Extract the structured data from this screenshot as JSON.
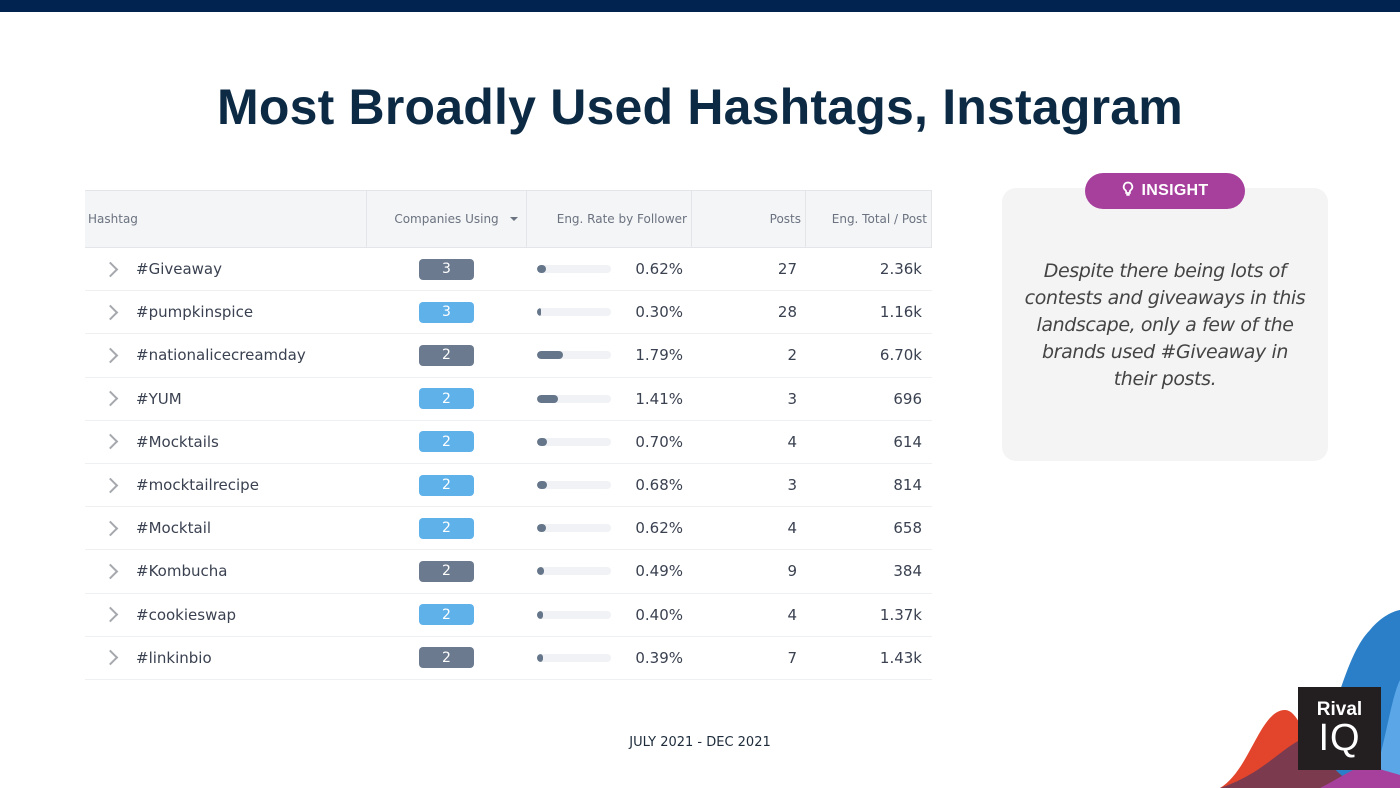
{
  "title": "Most Broadly Used Hashtags, Instagram",
  "table": {
    "headers": {
      "hashtag": "Hashtag",
      "companies_using": "Companies Using",
      "eng_rate": "Eng. Rate by Follower",
      "posts": "Posts",
      "eng_total": "Eng. Total / Post"
    },
    "eng_rate_scale_max_percent": 5,
    "rows": [
      {
        "hashtag": "#Giveaway",
        "companies": "3",
        "badge": "dark",
        "rate": "0.62%",
        "rate_value": 0.62,
        "posts": "27",
        "eng_total": "2.36k"
      },
      {
        "hashtag": "#pumpkinspice",
        "companies": "3",
        "badge": "light",
        "rate": "0.30%",
        "rate_value": 0.3,
        "posts": "28",
        "eng_total": "1.16k"
      },
      {
        "hashtag": "#nationalicecreamday",
        "companies": "2",
        "badge": "dark",
        "rate": "1.79%",
        "rate_value": 1.79,
        "posts": "2",
        "eng_total": "6.70k"
      },
      {
        "hashtag": "#YUM",
        "companies": "2",
        "badge": "light",
        "rate": "1.41%",
        "rate_value": 1.41,
        "posts": "3",
        "eng_total": "696"
      },
      {
        "hashtag": "#Mocktails",
        "companies": "2",
        "badge": "light",
        "rate": "0.70%",
        "rate_value": 0.7,
        "posts": "4",
        "eng_total": "614"
      },
      {
        "hashtag": "#mocktailrecipe",
        "companies": "2",
        "badge": "light",
        "rate": "0.68%",
        "rate_value": 0.68,
        "posts": "3",
        "eng_total": "814"
      },
      {
        "hashtag": "#Mocktail",
        "companies": "2",
        "badge": "light",
        "rate": "0.62%",
        "rate_value": 0.62,
        "posts": "4",
        "eng_total": "658"
      },
      {
        "hashtag": "#Kombucha",
        "companies": "2",
        "badge": "dark",
        "rate": "0.49%",
        "rate_value": 0.49,
        "posts": "9",
        "eng_total": "384"
      },
      {
        "hashtag": "#cookieswap",
        "companies": "2",
        "badge": "light",
        "rate": "0.40%",
        "rate_value": 0.4,
        "posts": "4",
        "eng_total": "1.37k"
      },
      {
        "hashtag": "#linkinbio",
        "companies": "2",
        "badge": "dark",
        "rate": "0.39%",
        "rate_value": 0.39,
        "posts": "7",
        "eng_total": "1.43k"
      }
    ]
  },
  "insight": {
    "label": "INSIGHT",
    "icon": "lightbulb-icon",
    "text": "Despite there being lots of contests and giveaways in this landscape, only a few of the brands used #Giveaway in their posts."
  },
  "footer": {
    "date_range": "JULY 2021 - DEC 2021"
  },
  "logo": {
    "line1": "Rival",
    "line2": "IQ"
  },
  "colors": {
    "topbar": "#00234f",
    "title": "#0c2a44",
    "badge_dark": "#6b7a8e",
    "badge_light": "#5fb1ea",
    "insight_pill": "#a6409c",
    "bar_fill": "#66768a"
  }
}
